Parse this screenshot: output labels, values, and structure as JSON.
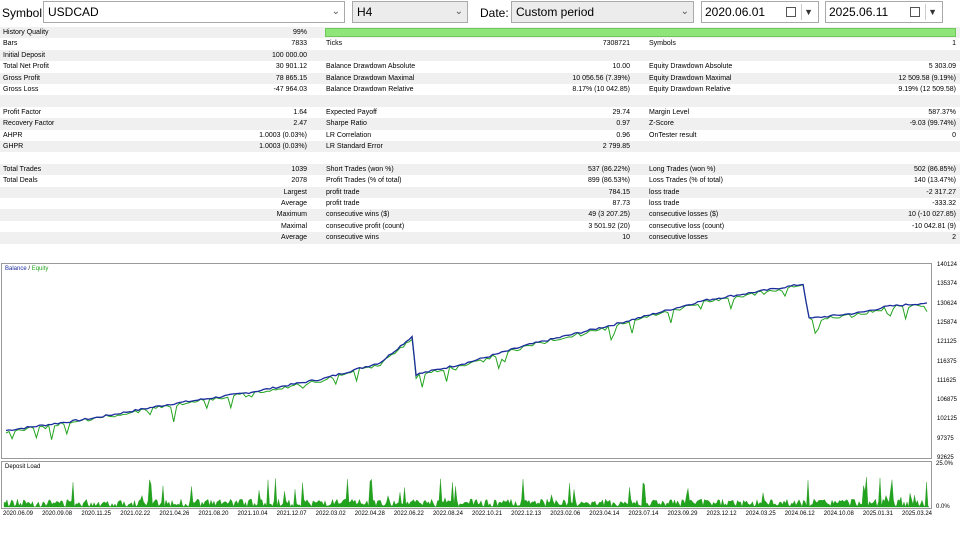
{
  "toolbar": {
    "symbol_label": "Symbol:",
    "symbol_value": "USDCAD",
    "timeframe_value": "H4",
    "date_label": "Date:",
    "period_value": "Custom period",
    "date_from": "2020.06.01",
    "date_to": "2025.06.11"
  },
  "stats": {
    "history_quality": {
      "label": "History Quality",
      "value": "99%"
    },
    "rows": [
      {
        "c1": "Bars",
        "v1": "7833",
        "c2": "Ticks",
        "v2": "7308721",
        "c3": "Symbols",
        "v3": "1"
      },
      {
        "c1": "Initial Deposit",
        "v1": "100 000.00",
        "c2": "",
        "v2": "",
        "c3": "",
        "v3": ""
      },
      {
        "c1": "Total Net Profit",
        "v1": "30 901.12",
        "c2": "Balance Drawdown Absolute",
        "v2": "10.00",
        "c3": "Equity Drawdown Absolute",
        "v3": "5 303.09"
      },
      {
        "c1": "Gross Profit",
        "v1": "78 865.15",
        "c2": "Balance Drawdown Maximal",
        "v2": "10 056.56 (7.39%)",
        "c3": "Equity Drawdown Maximal",
        "v3": "12 509.58 (9.19%)"
      },
      {
        "c1": "Gross Loss",
        "v1": "-47 964.03",
        "c2": "Balance Drawdown Relative",
        "v2": "8.17% (10 042.85)",
        "c3": "Equity Drawdown Relative",
        "v3": "9.19% (12 509.58)"
      },
      {
        "c1": "",
        "v1": "",
        "c2": "",
        "v2": "",
        "c3": "",
        "v3": ""
      },
      {
        "c1": "Profit Factor",
        "v1": "1.64",
        "c2": "Expected Payoff",
        "v2": "29.74",
        "c3": "Margin Level",
        "v3": "587.37%"
      },
      {
        "c1": "Recovery Factor",
        "v1": "2.47",
        "c2": "Sharpe Ratio",
        "v2": "0.97",
        "c3": "Z-Score",
        "v3": "-9.03 (99.74%)"
      },
      {
        "c1": "AHPR",
        "v1": "1.0003 (0.03%)",
        "c2": "LR Correlation",
        "v2": "0.96",
        "c3": "OnTester result",
        "v3": "0"
      },
      {
        "c1": "GHPR",
        "v1": "1.0003 (0.03%)",
        "c2": "LR Standard Error",
        "v2": "2 799.85",
        "c3": "",
        "v3": ""
      },
      {
        "c1": "",
        "v1": "",
        "c2": "",
        "v2": "",
        "c3": "",
        "v3": ""
      },
      {
        "c1": "Total Trades",
        "v1": "1039",
        "c2": "Short Trades (won %)",
        "v2": "537 (86.22%)",
        "c3": "Long Trades (won %)",
        "v3": "502 (86.85%)"
      },
      {
        "c1": "Total Deals",
        "v1": "2078",
        "c2": "Profit Trades (% of total)",
        "v2": "899 (86.53%)",
        "c3": "Loss Trades (% of total)",
        "v3": "140 (13.47%)"
      },
      {
        "c1": "",
        "v1": "Largest",
        "c2": "profit trade",
        "v2": "784.15",
        "c3": "loss trade",
        "v3": "-2 317.27"
      },
      {
        "c1": "",
        "v1": "Average",
        "c2": "profit trade",
        "v2": "87.73",
        "c3": "loss trade",
        "v3": "-333.32"
      },
      {
        "c1": "",
        "v1": "Maximum",
        "c2": "consecutive wins ($)",
        "v2": "49 (3 207.25)",
        "c3": "consecutive losses ($)",
        "v3": "10 (-10 027.85)"
      },
      {
        "c1": "",
        "v1": "Maximal",
        "c2": "consecutive profit (count)",
        "v2": "3 501.92 (20)",
        "c3": "consecutive loss (count)",
        "v3": "-10 042.81 (9)"
      },
      {
        "c1": "",
        "v1": "Average",
        "c2": "consecutive wins",
        "v2": "10",
        "c3": "consecutive losses",
        "v3": "2"
      }
    ]
  },
  "balance_chart": {
    "legend_balance": "Balance",
    "legend_sep": " / ",
    "legend_equity": "Equity",
    "balance_color": "#1c2d9c",
    "equity_color": "#22a31e",
    "y_ticks": [
      "140124",
      "135374",
      "130624",
      "125874",
      "121125",
      "116375",
      "111625",
      "106875",
      "102125",
      "97375",
      "92625"
    ]
  },
  "deposit_chart": {
    "title": "Deposit Load",
    "y_ticks": [
      "25.0%",
      "0.0%"
    ]
  },
  "x_ticks": [
    "2020.06.09",
    "2020.09.08",
    "2020.11.25",
    "2021.02.22",
    "2021.04.26",
    "2021.08.20",
    "2021.10.04",
    "2021.12.07",
    "2022.03.02",
    "2022.04.28",
    "2022.06.22",
    "2022.08.24",
    "2022.10.21",
    "2022.12.13",
    "2023.02.06",
    "2023.04.14",
    "2023.07.14",
    "2023.09.29",
    "2023.12.12",
    "2024.03.25",
    "2024.06.12",
    "2024.10.08",
    "2025.01.31",
    "2025.03.24"
  ],
  "chart_data": {
    "type": "line",
    "series": [
      {
        "name": "Balance",
        "x": [
          "2020.06.09",
          "2020.11.25",
          "2021.04.26",
          "2021.10.04",
          "2022.03.02",
          "2022.06.22",
          "2022.08.24",
          "2022.09.01",
          "2022.12.13",
          "2023.04.14",
          "2023.09.29",
          "2024.03.25",
          "2024.10.08",
          "2024.10.20",
          "2025.01.31",
          "2025.03.24",
          "2025.06.11"
        ],
        "values": [
          99000,
          102000,
          105500,
          108500,
          112000,
          116000,
          122500,
          113000,
          116000,
          120500,
          125500,
          131500,
          135600,
          127000,
          128500,
          130000,
          130900
        ]
      }
    ],
    "ylim": [
      92625,
      140124
    ]
  }
}
